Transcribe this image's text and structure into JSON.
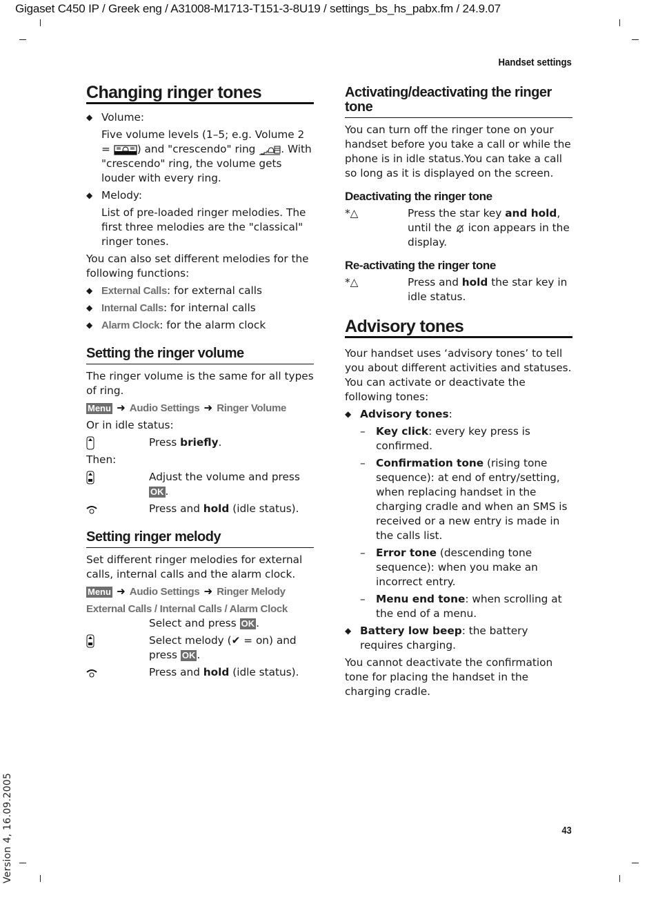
{
  "header": {
    "doc_path": "Gigaset C450 IP / Greek eng / A31008-M1713-T151-3-8U19 / settings_bs_hs_pabx.fm / 24.9.07",
    "running_title": "Handset settings",
    "version": "Version 4, 16.09.2005",
    "page_number": "43"
  },
  "left": {
    "title": "Changing ringer tones",
    "volume_label": "Volume:",
    "volume_text_1": "Five volume levels (1–5; e.g. Volume 2 =",
    "volume_text_2": ") and \"crescendo\" ring",
    "volume_text_3": ". With \"crescendo\" ring, the volume gets louder with every ring.",
    "melody_label": "Melody:",
    "melody_text": "List of pre-loaded ringer melodies. The first three melodies are the \"classical\" ringer tones.",
    "also_text": "You can also set different melodies for the following functions:",
    "functions": [
      {
        "item": "External Calls",
        "desc": ": for external calls"
      },
      {
        "item": "Internal Calls",
        "desc": ": for internal calls"
      },
      {
        "item": "Alarm Clock",
        "desc": ": for the alarm clock"
      }
    ],
    "vol_section": {
      "title": "Setting the ringer volume",
      "intro": "The ringer volume is the same for all types of ring.",
      "menu_tag": "Menu",
      "path": [
        "Audio Settings",
        "Ringer Volume"
      ],
      "or_idle": "Or in idle status:",
      "step1_a": "Press ",
      "step1_b": "briefly",
      "step1_c": ".",
      "then": "Then:",
      "step2_a": "Adjust the volume and press ",
      "ok": "OK",
      "step3_a": "Press and ",
      "step3_b": "hold",
      "step3_c": " (idle status)."
    },
    "mel_section": {
      "title": "Setting ringer melody",
      "intro": "Set different ringer melodies for external calls, internal calls and the alarm clock.",
      "menu_tag": "Menu",
      "path": [
        "Audio Settings",
        "Ringer Melody"
      ],
      "options": [
        "External Calls",
        "Internal Calls",
        "Alarm Clock"
      ],
      "sep": " / ",
      "select_press": "Select and press ",
      "ok": "OK",
      "step1_a": "Select melody (",
      "step1_b": " = on) and press ",
      "step2_a": "Press and ",
      "step2_b": "hold",
      "step2_c": " (idle status)."
    }
  },
  "right": {
    "act_title": "Activating/deactivating the ringer tone",
    "act_intro": "You can turn off the ringer tone on your handset before you take a call or while the phone is in idle status.You can take a call so long as it is displayed on the screen.",
    "deact_title": "Deactivating the ringer tone",
    "deact_a": "Press the star key ",
    "deact_b": "and hold",
    "deact_c": ", until the ",
    "deact_d": " icon appears in the display.",
    "react_title": "Re-activating the ringer tone",
    "react_a": "Press and ",
    "react_b": "hold",
    "react_c": " the star key in idle status.",
    "adv_title": "Advisory tones",
    "adv_intro": "Your handset uses ‘advisory tones’ to tell you about different activities and statuses. You can activate or deactivate the following tones:",
    "adv_label": "Advisory tones",
    "tones": [
      {
        "name": "Key click",
        "desc": ": every key press is confirmed."
      },
      {
        "name": "Confirmation tone",
        "desc": " (rising tone sequence): at end of entry/setting, when replacing handset in the charging cradle and when an SMS is received or a new entry is made in the calls list."
      },
      {
        "name": "Error tone",
        "desc": " (descending tone sequence): when you make an incorrect entry."
      },
      {
        "name": "Menu end tone",
        "desc": ": when scrolling at the end of a menu."
      }
    ],
    "battery_name": "Battery low beep",
    "battery_desc": ": the battery requires charging.",
    "footer_note": "You cannot deactivate the confirmation tone for placing the handset in the charging cradle."
  }
}
